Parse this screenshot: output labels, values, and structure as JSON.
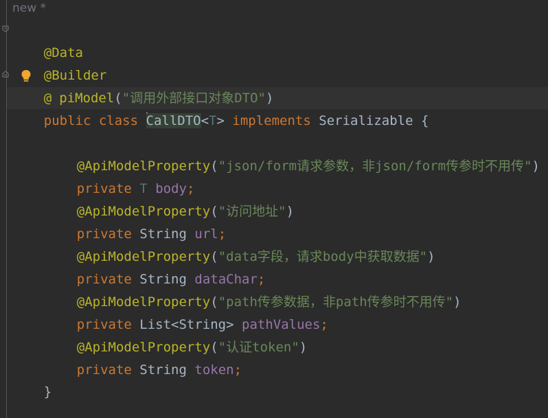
{
  "file": {
    "name": "new *"
  },
  "code": {
    "line1": {
      "annotation": "@Data"
    },
    "line2": {
      "annotation": "@Builder"
    },
    "line3": {
      "at": "@",
      "annotation_rest": "piModel",
      "open": "(",
      "string": "\"调用外部接口对象DTO\"",
      "close": ")"
    },
    "line4": {
      "kw1": "public",
      "kw2": "class",
      "classname": "CallDTO",
      "lt": "<",
      "typeparam": "T",
      "gt": ">",
      "kw3": "implements",
      "iface": "Serializable",
      "brace": "{"
    },
    "line6": {
      "annotation": "@ApiModelProperty",
      "open": "(",
      "string": "\"json/form请求参数，非json/form传参时不用传\"",
      "close": ")"
    },
    "line7": {
      "kw": "private",
      "type": "T",
      "field": "body",
      "semi": ";"
    },
    "line8": {
      "annotation": "@ApiModelProperty",
      "open": "(",
      "string": "\"访问地址\"",
      "close": ")"
    },
    "line9": {
      "kw": "private",
      "type": "String",
      "field": "url",
      "semi": ";"
    },
    "line10": {
      "annotation": "@ApiModelProperty",
      "open": "(",
      "string": "\"data字段，请求body中获取数据\"",
      "close": ")"
    },
    "line11": {
      "kw": "private",
      "type": "String",
      "field": "dataChar",
      "semi": ";"
    },
    "line12": {
      "annotation": "@ApiModelProperty",
      "open": "(",
      "string": "\"path传参数据，非path传参时不用传\"",
      "close": ")"
    },
    "line13": {
      "kw": "private",
      "type": "List<String>",
      "field": "pathValues",
      "semi": ";"
    },
    "line14": {
      "annotation": "@ApiModelProperty",
      "open": "(",
      "string": "\"认证token\"",
      "close": ")"
    },
    "line15": {
      "kw": "private",
      "type": "String",
      "field": "token",
      "semi": ";"
    },
    "line16": {
      "brace": "}"
    }
  },
  "icons": {
    "intention_bulb": "lightbulb-icon",
    "fold": "fold-marker-icon"
  },
  "colors": {
    "background": "#2b2b2b",
    "annotation": "#bbb529",
    "keyword": "#cc7832",
    "string": "#6a8759",
    "field": "#9876aa",
    "type_param": "#507874",
    "plain": "#a9b7c6",
    "bulb": "#f0a732"
  }
}
